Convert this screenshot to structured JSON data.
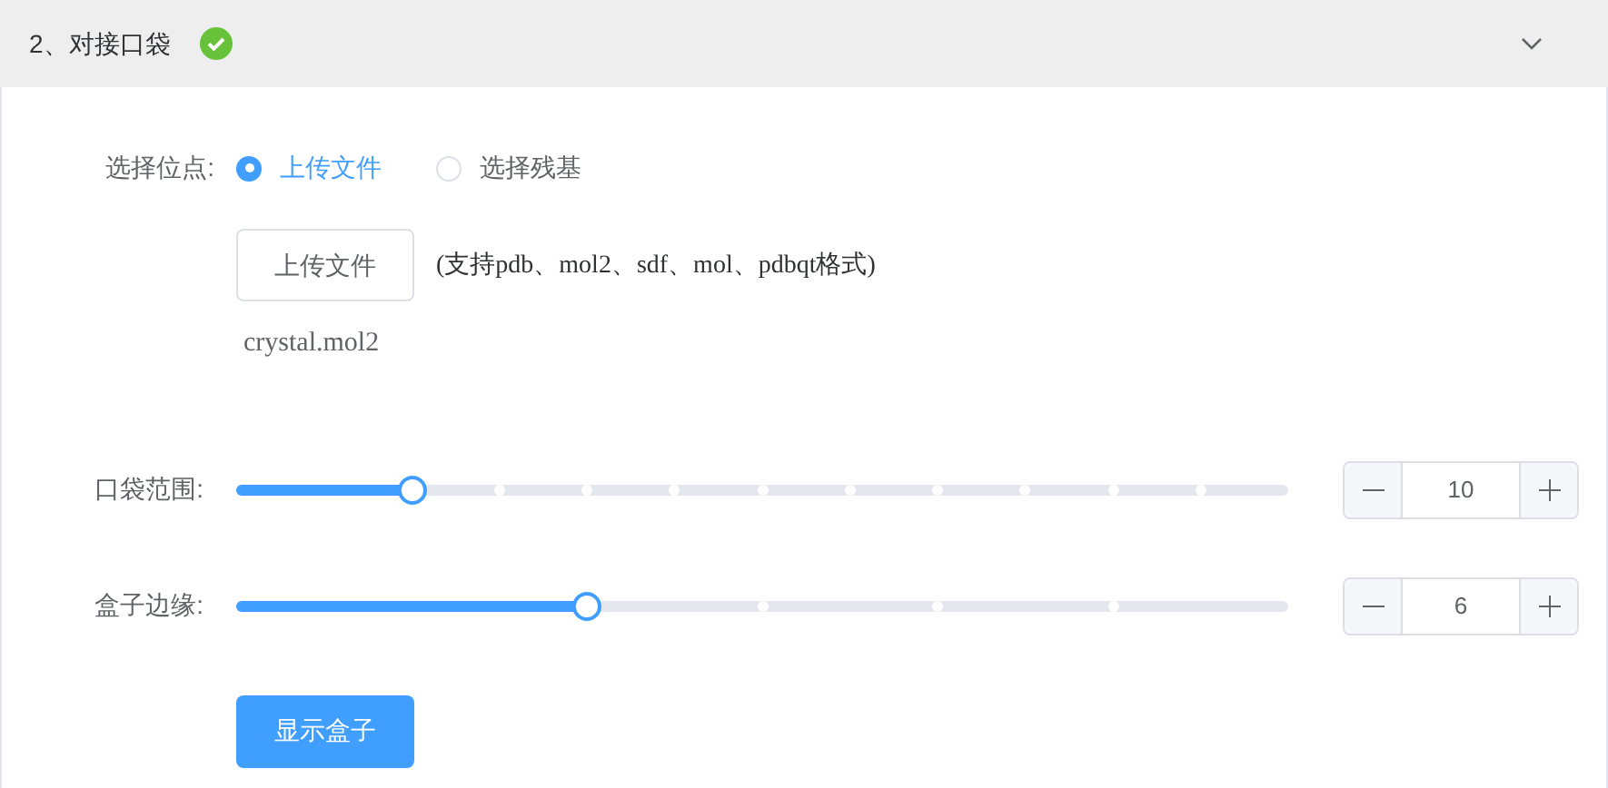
{
  "section": {
    "title": "2、对接口袋",
    "done": true,
    "expanded": true
  },
  "site": {
    "label": "选择位点:",
    "options": [
      {
        "label": "上传文件",
        "selected": true
      },
      {
        "label": "选择残基",
        "selected": false
      }
    ]
  },
  "upload": {
    "button": "上传文件",
    "hint": "(支持pdb、mol2、sdf、mol、pdbqt格式)",
    "file": "crystal.mol2"
  },
  "sliders": [
    {
      "label": "口袋范围:",
      "level": 0.1675,
      "value": "10"
    },
    {
      "label": "盒子边缘:",
      "level": 0.333,
      "value": "6"
    }
  ],
  "show_button": "显示盒子"
}
